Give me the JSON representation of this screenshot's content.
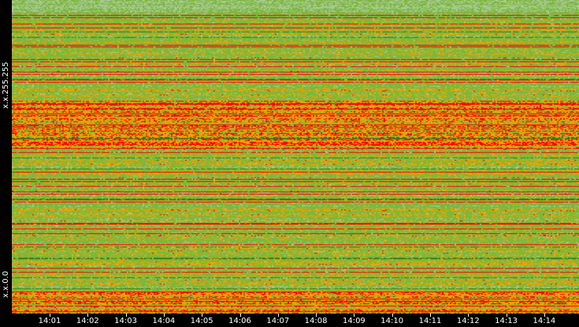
{
  "chart_data": {
    "type": "heatmap",
    "title": "",
    "ylabels": [
      "x.x.255.255",
      "x.x.0.0"
    ],
    "xticks": [
      "14:01",
      "14:02",
      "14:03",
      "14:04",
      "14:05",
      "14:06",
      "14:07",
      "14:08",
      "14:09",
      "14:10",
      "14:11",
      "14:12",
      "14:13",
      "14:14"
    ],
    "xrange": [
      "14:00",
      "14:15"
    ],
    "colors": {
      "low": "#7cb83a",
      "mid": "#f5a300",
      "high": "#ff0000",
      "dark": "#3d7a1e",
      "faint": "#a8c896"
    }
  }
}
